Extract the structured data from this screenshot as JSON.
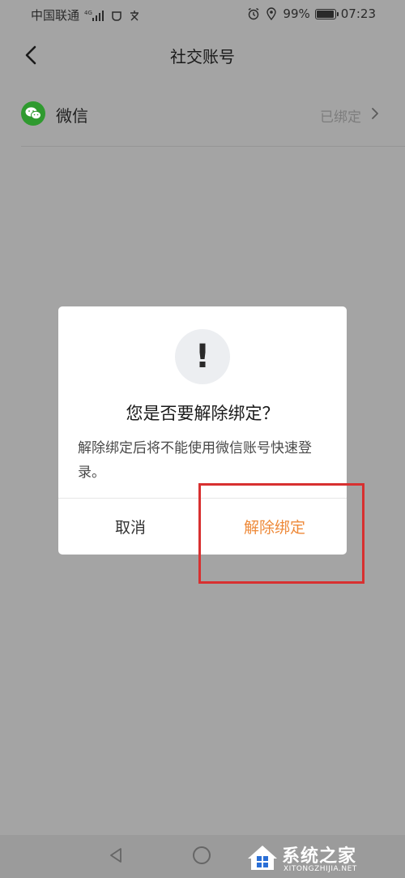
{
  "status_bar": {
    "carrier": "中国联通",
    "network": "4G",
    "battery": "99%",
    "time": "07:23"
  },
  "header": {
    "title": "社交账号"
  },
  "accounts": [
    {
      "name": "微信",
      "status": "已绑定"
    }
  ],
  "dialog": {
    "icon": "!",
    "title": "您是否要解除绑定？",
    "message": "解除绑定后将不能使用微信账号快速登录。",
    "cancel_label": "取消",
    "confirm_label": "解除绑定"
  },
  "colors": {
    "overlay": "#a4a4a4",
    "confirm": "#ee8a3a",
    "wechat": "#2f9a2f",
    "highlight": "#d83030"
  },
  "watermark": {
    "text": "系统之家",
    "sub": "XITONGZHIJIA.NET"
  }
}
